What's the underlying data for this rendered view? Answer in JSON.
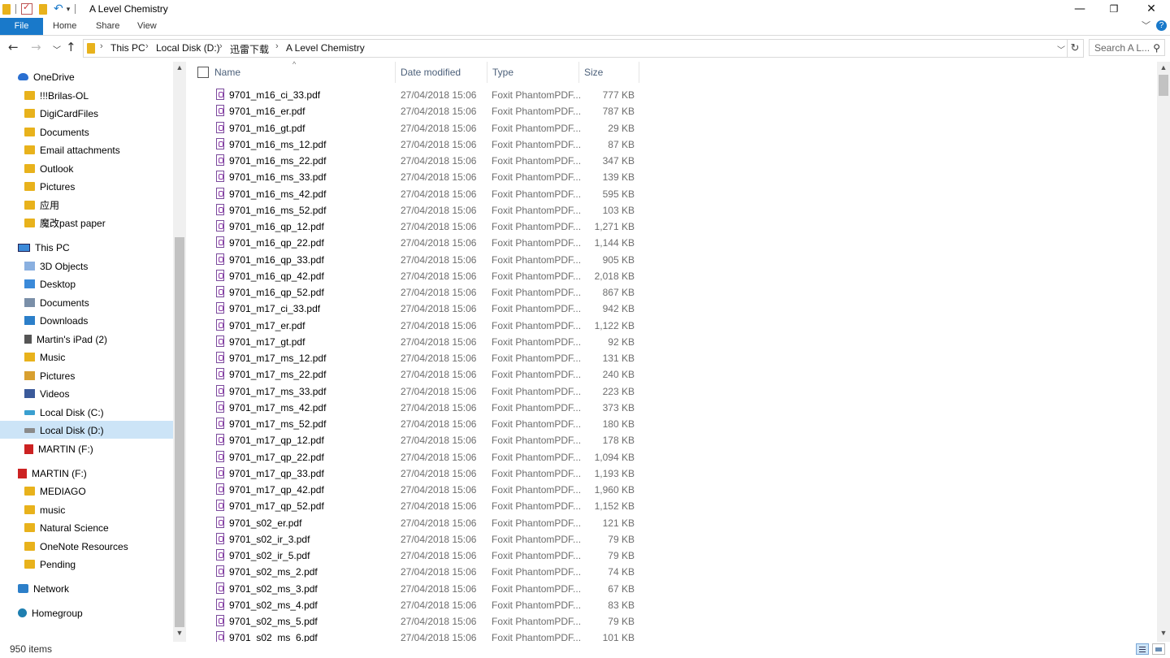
{
  "window": {
    "title": "A Level Chemistry",
    "minimize": "—",
    "restore": "❐",
    "close": "✕"
  },
  "ribbon": {
    "tabs": [
      "File",
      "Home",
      "Share",
      "View"
    ]
  },
  "address": {
    "crumbs": [
      "This PC",
      "Local Disk (D:)",
      "迅雷下载",
      "A Level Chemistry"
    ],
    "search_placeholder": "Search A L..."
  },
  "nav": {
    "onedrive": {
      "label": "OneDrive",
      "items": [
        "!!!Brilas-OL",
        "DigiCardFiles",
        "Documents",
        "Email attachments",
        "Outlook",
        "Pictures",
        "应用",
        "魔改past paper"
      ]
    },
    "thispc": {
      "label": "This PC",
      "items": [
        "3D Objects",
        "Desktop",
        "Documents",
        "Downloads",
        "Martin's iPad (2)",
        "Music",
        "Pictures",
        "Videos",
        "Local Disk (C:)",
        "Local Disk (D:)",
        "MARTIN (F:)"
      ]
    },
    "martin": {
      "label": "MARTIN (F:)",
      "items": [
        "MEDIAGO",
        "music",
        "Natural Science",
        "OneNote Resources",
        "Pending"
      ]
    },
    "network": "Network",
    "homegroup": "Homegroup"
  },
  "columns": {
    "name": "Name",
    "date": "Date modified",
    "type": "Type",
    "size": "Size"
  },
  "files": [
    {
      "name": "9701_m16_ci_33.pdf",
      "date": "27/04/2018 15:06",
      "type": "Foxit PhantomPDF...",
      "size": "777 KB"
    },
    {
      "name": "9701_m16_er.pdf",
      "date": "27/04/2018 15:06",
      "type": "Foxit PhantomPDF...",
      "size": "787 KB"
    },
    {
      "name": "9701_m16_gt.pdf",
      "date": "27/04/2018 15:06",
      "type": "Foxit PhantomPDF...",
      "size": "29 KB"
    },
    {
      "name": "9701_m16_ms_12.pdf",
      "date": "27/04/2018 15:06",
      "type": "Foxit PhantomPDF...",
      "size": "87 KB"
    },
    {
      "name": "9701_m16_ms_22.pdf",
      "date": "27/04/2018 15:06",
      "type": "Foxit PhantomPDF...",
      "size": "347 KB"
    },
    {
      "name": "9701_m16_ms_33.pdf",
      "date": "27/04/2018 15:06",
      "type": "Foxit PhantomPDF...",
      "size": "139 KB"
    },
    {
      "name": "9701_m16_ms_42.pdf",
      "date": "27/04/2018 15:06",
      "type": "Foxit PhantomPDF...",
      "size": "595 KB"
    },
    {
      "name": "9701_m16_ms_52.pdf",
      "date": "27/04/2018 15:06",
      "type": "Foxit PhantomPDF...",
      "size": "103 KB"
    },
    {
      "name": "9701_m16_qp_12.pdf",
      "date": "27/04/2018 15:06",
      "type": "Foxit PhantomPDF...",
      "size": "1,271 KB"
    },
    {
      "name": "9701_m16_qp_22.pdf",
      "date": "27/04/2018 15:06",
      "type": "Foxit PhantomPDF...",
      "size": "1,144 KB"
    },
    {
      "name": "9701_m16_qp_33.pdf",
      "date": "27/04/2018 15:06",
      "type": "Foxit PhantomPDF...",
      "size": "905 KB"
    },
    {
      "name": "9701_m16_qp_42.pdf",
      "date": "27/04/2018 15:06",
      "type": "Foxit PhantomPDF...",
      "size": "2,018 KB"
    },
    {
      "name": "9701_m16_qp_52.pdf",
      "date": "27/04/2018 15:06",
      "type": "Foxit PhantomPDF...",
      "size": "867 KB"
    },
    {
      "name": "9701_m17_ci_33.pdf",
      "date": "27/04/2018 15:06",
      "type": "Foxit PhantomPDF...",
      "size": "942 KB"
    },
    {
      "name": "9701_m17_er.pdf",
      "date": "27/04/2018 15:06",
      "type": "Foxit PhantomPDF...",
      "size": "1,122 KB"
    },
    {
      "name": "9701_m17_gt.pdf",
      "date": "27/04/2018 15:06",
      "type": "Foxit PhantomPDF...",
      "size": "92 KB"
    },
    {
      "name": "9701_m17_ms_12.pdf",
      "date": "27/04/2018 15:06",
      "type": "Foxit PhantomPDF...",
      "size": "131 KB"
    },
    {
      "name": "9701_m17_ms_22.pdf",
      "date": "27/04/2018 15:06",
      "type": "Foxit PhantomPDF...",
      "size": "240 KB"
    },
    {
      "name": "9701_m17_ms_33.pdf",
      "date": "27/04/2018 15:06",
      "type": "Foxit PhantomPDF...",
      "size": "223 KB"
    },
    {
      "name": "9701_m17_ms_42.pdf",
      "date": "27/04/2018 15:06",
      "type": "Foxit PhantomPDF...",
      "size": "373 KB"
    },
    {
      "name": "9701_m17_ms_52.pdf",
      "date": "27/04/2018 15:06",
      "type": "Foxit PhantomPDF...",
      "size": "180 KB"
    },
    {
      "name": "9701_m17_qp_12.pdf",
      "date": "27/04/2018 15:06",
      "type": "Foxit PhantomPDF...",
      "size": "178 KB"
    },
    {
      "name": "9701_m17_qp_22.pdf",
      "date": "27/04/2018 15:06",
      "type": "Foxit PhantomPDF...",
      "size": "1,094 KB"
    },
    {
      "name": "9701_m17_qp_33.pdf",
      "date": "27/04/2018 15:06",
      "type": "Foxit PhantomPDF...",
      "size": "1,193 KB"
    },
    {
      "name": "9701_m17_qp_42.pdf",
      "date": "27/04/2018 15:06",
      "type": "Foxit PhantomPDF...",
      "size": "1,960 KB"
    },
    {
      "name": "9701_m17_qp_52.pdf",
      "date": "27/04/2018 15:06",
      "type": "Foxit PhantomPDF...",
      "size": "1,152 KB"
    },
    {
      "name": "9701_s02_er.pdf",
      "date": "27/04/2018 15:06",
      "type": "Foxit PhantomPDF...",
      "size": "121 KB"
    },
    {
      "name": "9701_s02_ir_3.pdf",
      "date": "27/04/2018 15:06",
      "type": "Foxit PhantomPDF...",
      "size": "79 KB"
    },
    {
      "name": "9701_s02_ir_5.pdf",
      "date": "27/04/2018 15:06",
      "type": "Foxit PhantomPDF...",
      "size": "79 KB"
    },
    {
      "name": "9701_s02_ms_2.pdf",
      "date": "27/04/2018 15:06",
      "type": "Foxit PhantomPDF...",
      "size": "74 KB"
    },
    {
      "name": "9701_s02_ms_3.pdf",
      "date": "27/04/2018 15:06",
      "type": "Foxit PhantomPDF...",
      "size": "67 KB"
    },
    {
      "name": "9701_s02_ms_4.pdf",
      "date": "27/04/2018 15:06",
      "type": "Foxit PhantomPDF...",
      "size": "83 KB"
    },
    {
      "name": "9701_s02_ms_5.pdf",
      "date": "27/04/2018 15:06",
      "type": "Foxit PhantomPDF...",
      "size": "79 KB"
    },
    {
      "name": "9701_s02_ms_6.pdf",
      "date": "27/04/2018 15:06",
      "type": "Foxit PhantomPDF...",
      "size": "101 KB"
    }
  ],
  "status": {
    "count": "950 items"
  },
  "colors": {
    "accent": "#1979ca",
    "selected": "#cce4f7"
  }
}
